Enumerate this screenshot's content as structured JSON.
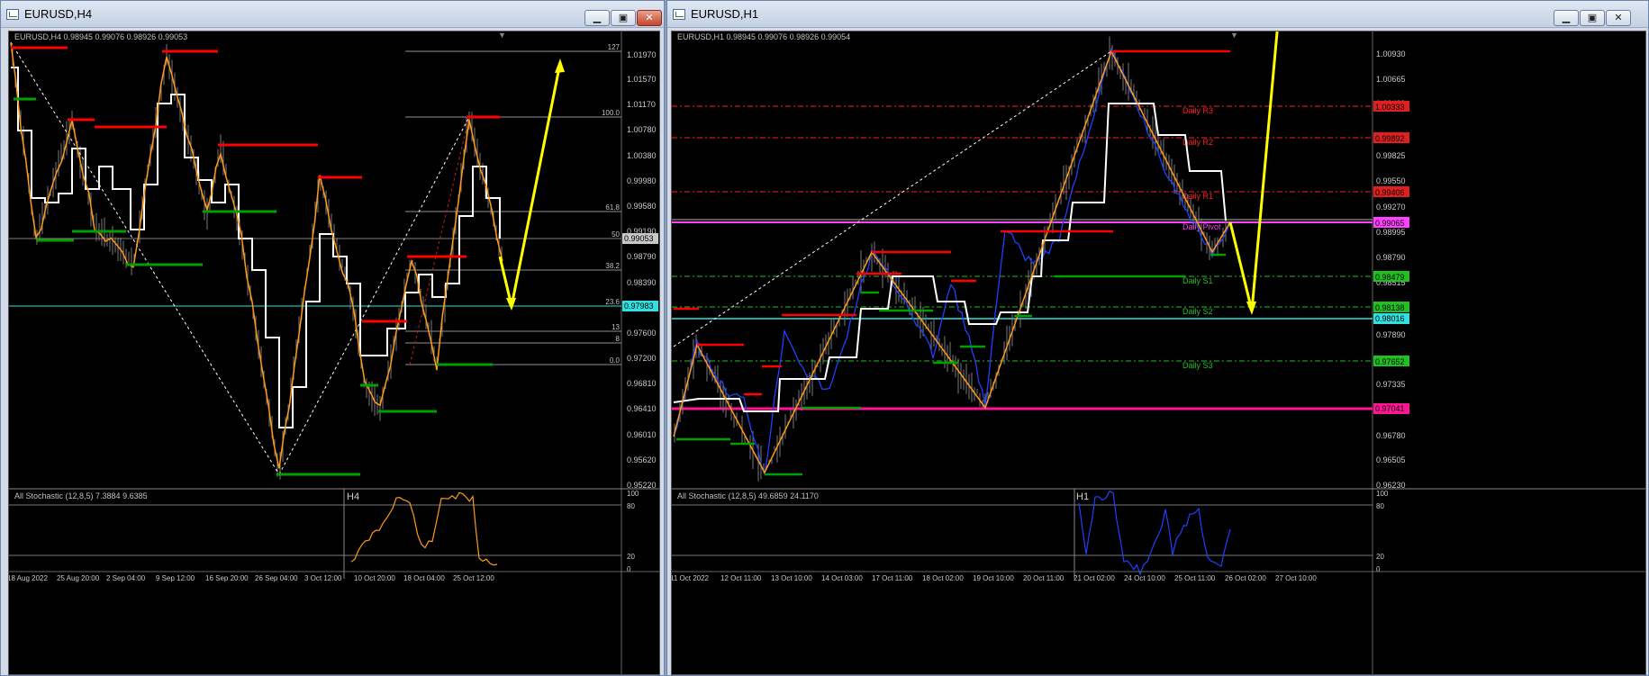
{
  "left": {
    "title": "EURUSD,H4",
    "header": "EURUSD,H4  0.98945 0.99076 0.98926 0.99053",
    "prices": [
      "1.01970",
      "1.01570",
      "1.01170",
      "1.00780",
      "1.00380",
      "0.99980",
      "0.99580",
      "0.99190",
      "0.98790",
      "0.98390",
      "0.97600",
      "0.97200",
      "0.96810",
      "0.96410",
      "0.96010",
      "0.95620",
      "0.95220"
    ],
    "current_price": "0.99053",
    "cyan_price": "0.97983",
    "fib": [
      "127",
      "100.0",
      "61.8",
      "50",
      "38.2",
      "23.6",
      "13",
      "8",
      "0.0"
    ],
    "osc_label": "All Stochastic (12,8,5) 7.3884 9.6385",
    "tf_label": "H4",
    "osc_scale": [
      "100",
      "80",
      "20",
      "0"
    ],
    "dates": [
      "18 Aug 2022",
      "25 Aug 20:00",
      "2 Sep 04:00",
      "9 Sep 12:00",
      "16 Sep 20:00",
      "26 Sep 04:00",
      "3 Oct 12:00",
      "10 Oct 20:00",
      "18 Oct 04:00",
      "25 Oct 12:00"
    ]
  },
  "right": {
    "title": "EURUSD,H1",
    "header": "EURUSD,H1  0.98945 0.99076 0.98926 0.99054",
    "prices": [
      "1.00930",
      "1.00665",
      "1.00400",
      "0.99825",
      "0.99550",
      "0.99270",
      "0.98995",
      "0.98790",
      "0.98515",
      "0.97890",
      "0.97610",
      "0.97335",
      "0.96780",
      "0.96505",
      "0.96230"
    ],
    "levels": [
      {
        "label": "Daily R3",
        "price": "1.00333",
        "color": "#ff2020"
      },
      {
        "label": "Daily R2",
        "price": "0.99892",
        "color": "#ff2020"
      },
      {
        "label": "Daily R1",
        "price": "0.99406",
        "color": "#ff2020"
      },
      {
        "label": "Daily Pivot",
        "price": "0.99065",
        "color": "#ff40ff"
      },
      {
        "label": "Daily S1",
        "price": "0.98479",
        "color": "#20c020"
      },
      {
        "label": "Daily S2",
        "price": "0.98138",
        "color": "#20c020"
      },
      {
        "label": "Daily S3",
        "price": "0.97652",
        "color": "#20c020"
      }
    ],
    "cyan_price": "0.98016",
    "magenta_price": "0.97041",
    "osc_label": "All Stochastic (12,8,5) 49.6859 24.1170",
    "tf_label": "H1",
    "osc_scale": [
      "100",
      "80",
      "20",
      "0"
    ],
    "dates": [
      "11 Oct 2022",
      "12 Oct 11:00",
      "13 Oct 10:00",
      "14 Oct 03:00",
      "17 Oct 11:00",
      "18 Oct 02:00",
      "19 Oct 10:00",
      "20 Oct 11:00",
      "21 Oct 02:00",
      "24 Oct 10:00",
      "25 Oct 11:00",
      "26 Oct 02:00",
      "27 Oct 10:00"
    ]
  },
  "colors": {
    "orange": "#ff9a1a",
    "yellow": "#ffff00",
    "red": "#ff0000",
    "green": "#00a000",
    "blue": "#2040ff",
    "cyan": "#30e0e0",
    "magenta": "#ff1493"
  },
  "icons": [
    "chart-window-icon",
    "minimize-icon",
    "restore-icon",
    "close-icon"
  ]
}
